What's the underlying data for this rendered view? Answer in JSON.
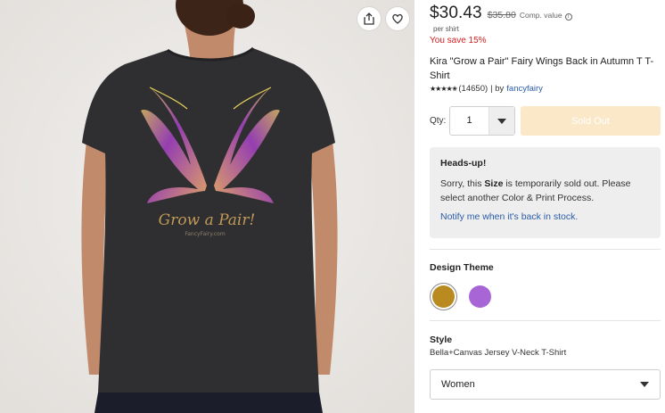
{
  "product_image": {
    "print_text": "Grow a Pair!",
    "print_subtext": "FancyFairy.com"
  },
  "image_actions": {
    "share_icon": "share-icon",
    "favorite_icon": "heart-icon"
  },
  "pricing": {
    "price": "$30.43",
    "original_price": "$35.80",
    "comp_label": "Comp. value",
    "unit": "per shirt",
    "savings": "You save 15%"
  },
  "product": {
    "title": "Kira \"Grow a Pair\" Fairy Wings Back in Autumn T T-Shirt",
    "rating_stars": 4.5,
    "review_count": "(14650)",
    "by_text": "| by",
    "seller": "fancyfairy"
  },
  "purchase": {
    "qty_label": "Qty:",
    "qty_value": "1",
    "sold_out_label": "Sold Out"
  },
  "alert": {
    "title": "Heads-up!",
    "msg_before": "Sorry, this",
    "msg_bold": "Size",
    "msg_after": "is temporarily sold out. Please select another Color & Print Process.",
    "link": "Notify me when it's back in stock."
  },
  "design_theme": {
    "title": "Design Theme",
    "options": [
      {
        "color": "#b88a1f",
        "selected": true
      },
      {
        "color": "#a865d6",
        "selected": false
      }
    ]
  },
  "style": {
    "title": "Style",
    "value": "Bella+Canvas Jersey V-Neck T-Shirt",
    "select_value": "Women"
  },
  "colors": {
    "shirt": "#2f2f31",
    "background": "#eceae7",
    "sale_red": "#d21f1f",
    "link_blue": "#2a5ca8",
    "sold_out_bg": "#fbe8c8"
  }
}
